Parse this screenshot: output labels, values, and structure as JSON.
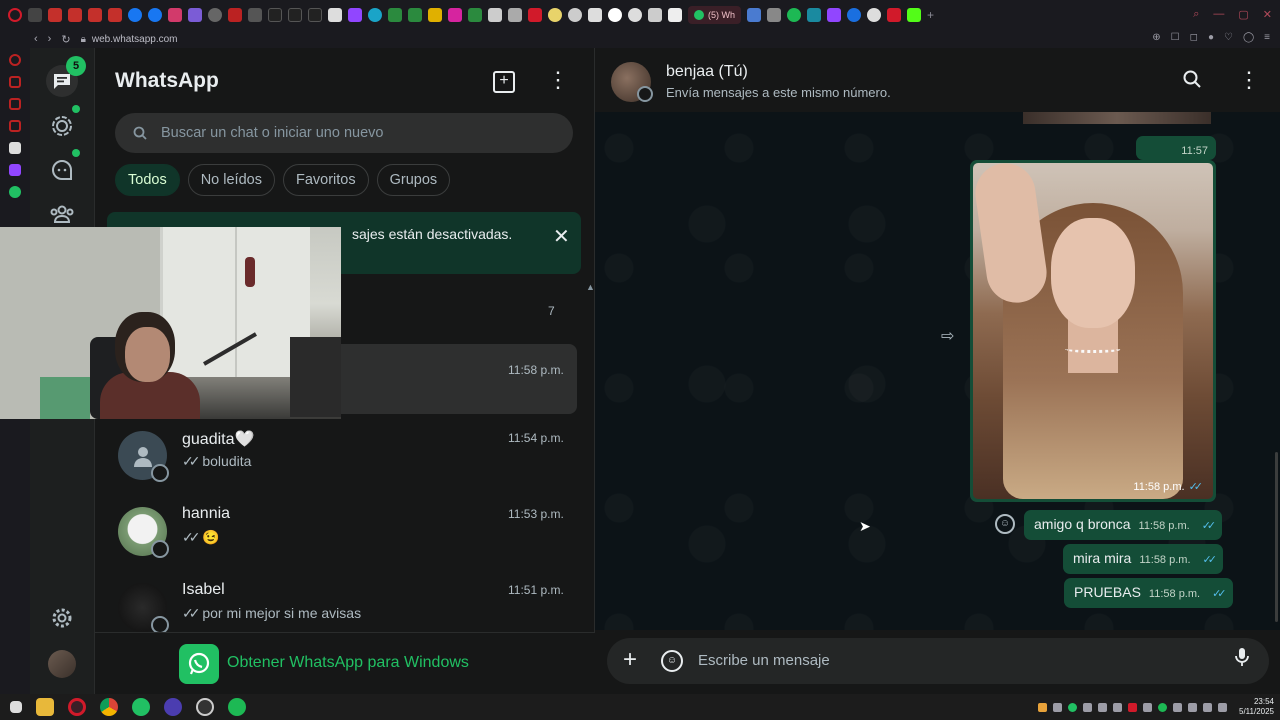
{
  "browser": {
    "active_tab_label": "(5) Wh",
    "url": "web.whatsapp.com"
  },
  "rail": {
    "chats_badge": "5"
  },
  "list": {
    "title": "WhatsApp",
    "search_placeholder": "Buscar un chat o iniciar uno nuevo",
    "filters": [
      "Todos",
      "No leídos",
      "Favoritos",
      "Grupos"
    ],
    "notice_text": "sajes están desactivadas.",
    "archived_count": "7",
    "selected_row_time": "11:58 p.m.",
    "chats": [
      {
        "name": "guadita🤍",
        "time": "11:54 p.m.",
        "preview": "boludita"
      },
      {
        "name": "hannia",
        "time": "11:53 p.m.",
        "preview": "😉"
      },
      {
        "name": "Isabel",
        "time": "11:51 p.m.",
        "preview": "por mi mejor si me avisas"
      }
    ],
    "get_app_label": "Obtener WhatsApp para Windows"
  },
  "conversation": {
    "name": "benjaa (Tú)",
    "subtitle": "Envía mensajes a este mismo número.",
    "messages": [
      {
        "type": "image_time",
        "time": "11:57 p.m."
      },
      {
        "type": "image",
        "time": "11:58 p.m."
      },
      {
        "type": "text",
        "text": "amigo q bronca",
        "time": "11:58 p.m."
      },
      {
        "type": "text",
        "text": "mira mira",
        "time": "11:58 p.m."
      },
      {
        "type": "text",
        "text": "PRUEBAS",
        "time": "11:58 p.m."
      }
    ],
    "composer_placeholder": "Escribe un mensaje"
  },
  "taskbar": {
    "time": "23:54",
    "date": "5/11/2025"
  },
  "colors": {
    "accent": "#21c063",
    "outgoing_bubble": "#144d37",
    "read_ticks": "#53bdeb"
  }
}
